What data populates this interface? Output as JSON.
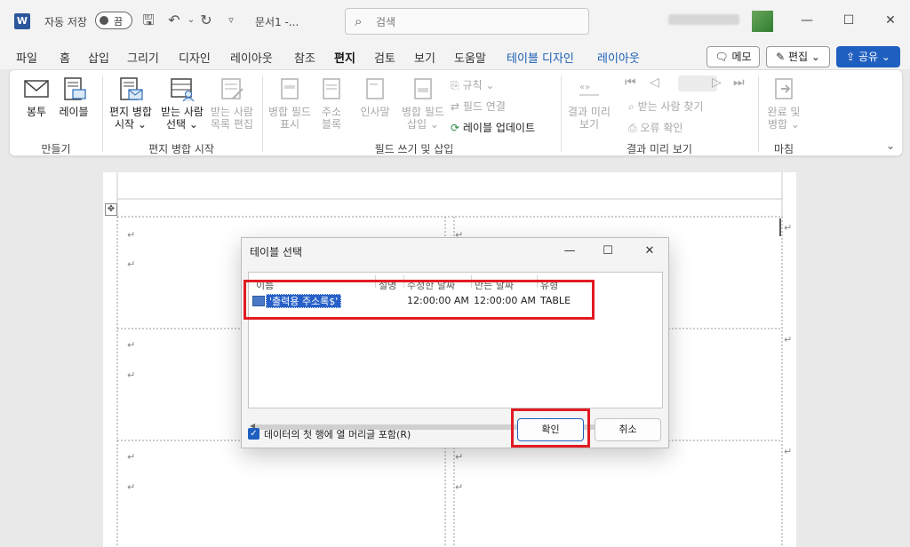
{
  "titlebar": {
    "logo": "W",
    "autosave_label": "자동 저장",
    "autosave_state": "끔",
    "doc_title": "문서1  -...",
    "search_placeholder": "검색"
  },
  "menu": {
    "tabs": [
      "파일",
      "홈",
      "삽입",
      "그리기",
      "디자인",
      "레이아웃",
      "참조",
      "편지",
      "검토",
      "보기",
      "도움말"
    ],
    "active_tab": "편지",
    "context_tabs": [
      "테이블 디자인",
      "레이아웃"
    ],
    "memo_label": "메모",
    "edit_label": "편집",
    "share_label": "공유"
  },
  "ribbon": {
    "groups": {
      "create": "만들기",
      "start_merge": "편지 병합 시작",
      "write_insert": "필드 쓰기 및 삽입",
      "preview": "결과 미리 보기",
      "finish": "마침"
    },
    "buttons": {
      "envelope": "봉투",
      "label": "레이블",
      "start_merge": "편지 병합 시작",
      "select_recipients": "받는 사람 선택",
      "edit_list": "받는 사람 목록 편집",
      "highlight_fields": "병합 필드 표시",
      "address_block": "주소 블록",
      "greeting_line": "인사말",
      "insert_merge_field": "병합 필드 삽입",
      "rules": "규칙",
      "match_fields": "필드 연결",
      "update_labels": "레이블 업데이트",
      "preview_results": "결과 미리 보기",
      "find_recipient": "받는 사람 찾기",
      "check_errors": "오류 확인",
      "finish_merge": "완료 및 병합"
    }
  },
  "dialog": {
    "title": "테이블 선택",
    "columns": [
      "이름",
      "설명",
      "수정한 날짜",
      "만든 날짜",
      "유형"
    ],
    "rows": [
      {
        "name": "'출력용 주소록$'",
        "description": "",
        "modified": "12:00:00 AM",
        "created": "12:00:00 AM",
        "type": "TABLE"
      }
    ],
    "first_row_header_label": "데이터의 첫 행에 열 머리글 포함(R)",
    "first_row_header_checked": true,
    "ok_label": "확인",
    "cancel_label": "취소"
  },
  "document": {
    "paragraph_mark": "↵",
    "table_move_handle": "✥"
  },
  "colors": {
    "accent": "#1f5fbf",
    "highlight_border": "#e11b22",
    "selection": "#2660c8"
  }
}
